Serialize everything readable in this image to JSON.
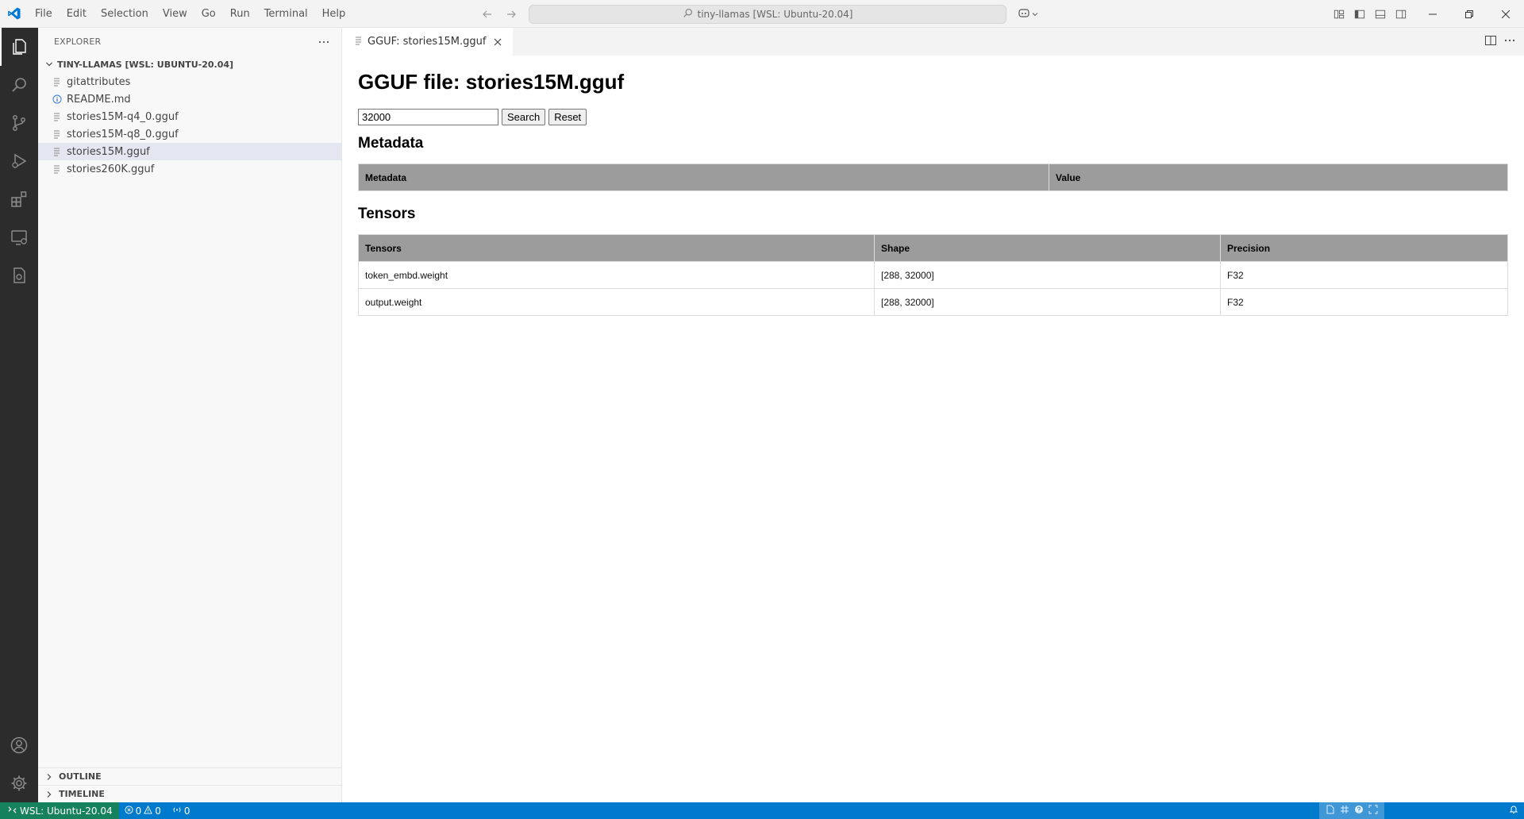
{
  "menu": [
    "File",
    "Edit",
    "Selection",
    "View",
    "Go",
    "Run",
    "Terminal",
    "Help"
  ],
  "command_center": {
    "label": "tiny-llamas [WSL: Ubuntu-20.04]"
  },
  "sidebar": {
    "title": "EXPLORER",
    "folder": "TINY-LLAMAS [WSL: UBUNTU-20.04]",
    "files": [
      {
        "name": "gitattributes",
        "icon": "lines-icon"
      },
      {
        "name": "README.md",
        "icon": "info-icon"
      },
      {
        "name": "stories15M-q4_0.gguf",
        "icon": "lines-icon"
      },
      {
        "name": "stories15M-q8_0.gguf",
        "icon": "lines-icon"
      },
      {
        "name": "stories15M.gguf",
        "icon": "lines-icon",
        "selected": true
      },
      {
        "name": "stories260K.gguf",
        "icon": "lines-icon"
      }
    ],
    "outline": "OUTLINE",
    "timeline": "TIMELINE"
  },
  "tab": {
    "label": "GGUF: stories15M.gguf"
  },
  "editor": {
    "title": "GGUF file: stories15M.gguf",
    "search_value": "32000",
    "search_label": "Search",
    "reset_label": "Reset",
    "metadata_heading": "Metadata",
    "metadata_table": {
      "headers": [
        "Metadata",
        "Value"
      ]
    },
    "tensors_heading": "Tensors",
    "tensors_table": {
      "headers": [
        "Tensors",
        "Shape",
        "Precision"
      ],
      "rows": [
        [
          "token_embd.weight",
          "[288, 32000]",
          "F32"
        ],
        [
          "output.weight",
          "[288, 32000]",
          "F32"
        ]
      ]
    }
  },
  "statusbar": {
    "remote": "WSL: Ubuntu-20.04",
    "errors": "0",
    "warnings": "0",
    "ports": "0"
  },
  "colors": {
    "accent": "#007acc",
    "remote": "#16825d",
    "activitybar": "#2c2c2c",
    "header_bg": "#9c9c9c"
  }
}
